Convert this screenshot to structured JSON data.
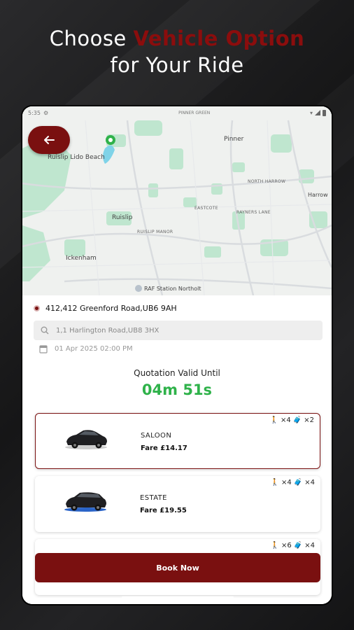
{
  "headline": {
    "line1_prefix": "Choose ",
    "line1_accent": "Vehicle Option",
    "line2": "for Your Ride"
  },
  "status_bar": {
    "time": "5:35",
    "center": "PINNER GREEN"
  },
  "map": {
    "labels": {
      "lido": "Ruislip Lido Beach",
      "pinner": "Pinner",
      "north_harrow": "NORTH HARROW",
      "harrow": "Harrow",
      "eastcote": "EASTCOTE",
      "rayners": "RAYNERS LANE",
      "ruislip": "Ruislip",
      "ruislip_manor": "RUISLIP MANOR",
      "ickenham": "Ickenham",
      "raf": "RAF Station Northolt"
    }
  },
  "trip": {
    "pickup": "412,412 Greenford Road,UB6 9AH",
    "destination": "1,1 Harlington Road,UB8 3HX",
    "datetime": "01 Apr 2025 02:00 PM"
  },
  "quotation": {
    "label": "Quotation Valid Until",
    "timer": "04m 51s"
  },
  "vehicles": [
    {
      "name": "SALOON",
      "fare": "Fare £14.17",
      "passengers": "×4",
      "luggage": "×2"
    },
    {
      "name": "ESTATE",
      "fare": "Fare £19.55",
      "passengers": "×4",
      "luggage": "×4"
    },
    {
      "passengers": "×6",
      "luggage": "×4"
    }
  ],
  "book_button": "Book Now",
  "colors": {
    "brand": "#7a1010",
    "timer": "#2fb24a"
  }
}
